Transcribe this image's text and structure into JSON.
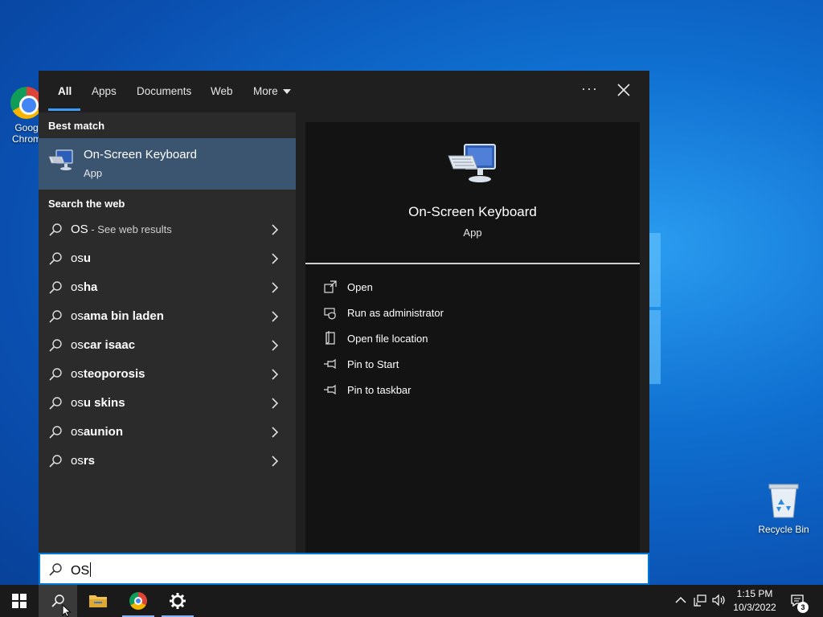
{
  "desktop": {
    "chrome_label": "Goog\nChrom",
    "recycle_label": "Recycle Bin"
  },
  "tabs": {
    "all": "All",
    "apps": "Apps",
    "documents": "Documents",
    "web": "Web",
    "more": "More",
    "ellipsis": "···"
  },
  "best_match": {
    "heading": "Best match",
    "title": "On-Screen Keyboard",
    "subtitle": "App"
  },
  "web_search": {
    "heading": "Search the web",
    "items": [
      {
        "prefix": "OS",
        "suffix": "",
        "note": " - See web results"
      },
      {
        "prefix": "os",
        "suffix": "u",
        "note": ""
      },
      {
        "prefix": "os",
        "suffix": "ha",
        "note": ""
      },
      {
        "prefix": "os",
        "suffix": "ama bin laden",
        "note": ""
      },
      {
        "prefix": "os",
        "suffix": "car isaac",
        "note": ""
      },
      {
        "prefix": "os",
        "suffix": "teoporosis",
        "note": ""
      },
      {
        "prefix": "os",
        "suffix": "u skins",
        "note": ""
      },
      {
        "prefix": "os",
        "suffix": "aunion",
        "note": ""
      },
      {
        "prefix": "os",
        "suffix": "rs",
        "note": ""
      }
    ]
  },
  "preview": {
    "title": "On-Screen Keyboard",
    "subtitle": "App",
    "actions": [
      {
        "label": "Open",
        "icon": "open-icon"
      },
      {
        "label": "Run as administrator",
        "icon": "shield-icon"
      },
      {
        "label": "Open file location",
        "icon": "file-location-icon"
      },
      {
        "label": "Pin to Start",
        "icon": "pin-icon"
      },
      {
        "label": "Pin to taskbar",
        "icon": "pin-icon"
      }
    ]
  },
  "search": {
    "value": "OS"
  },
  "tray": {
    "time": "1:15 PM",
    "date": "10/3/2022",
    "notification_count": "3"
  },
  "colors": {
    "accent": "#0078d7",
    "selection": "#3b5570",
    "tab_underline": "#3d9bf4"
  }
}
